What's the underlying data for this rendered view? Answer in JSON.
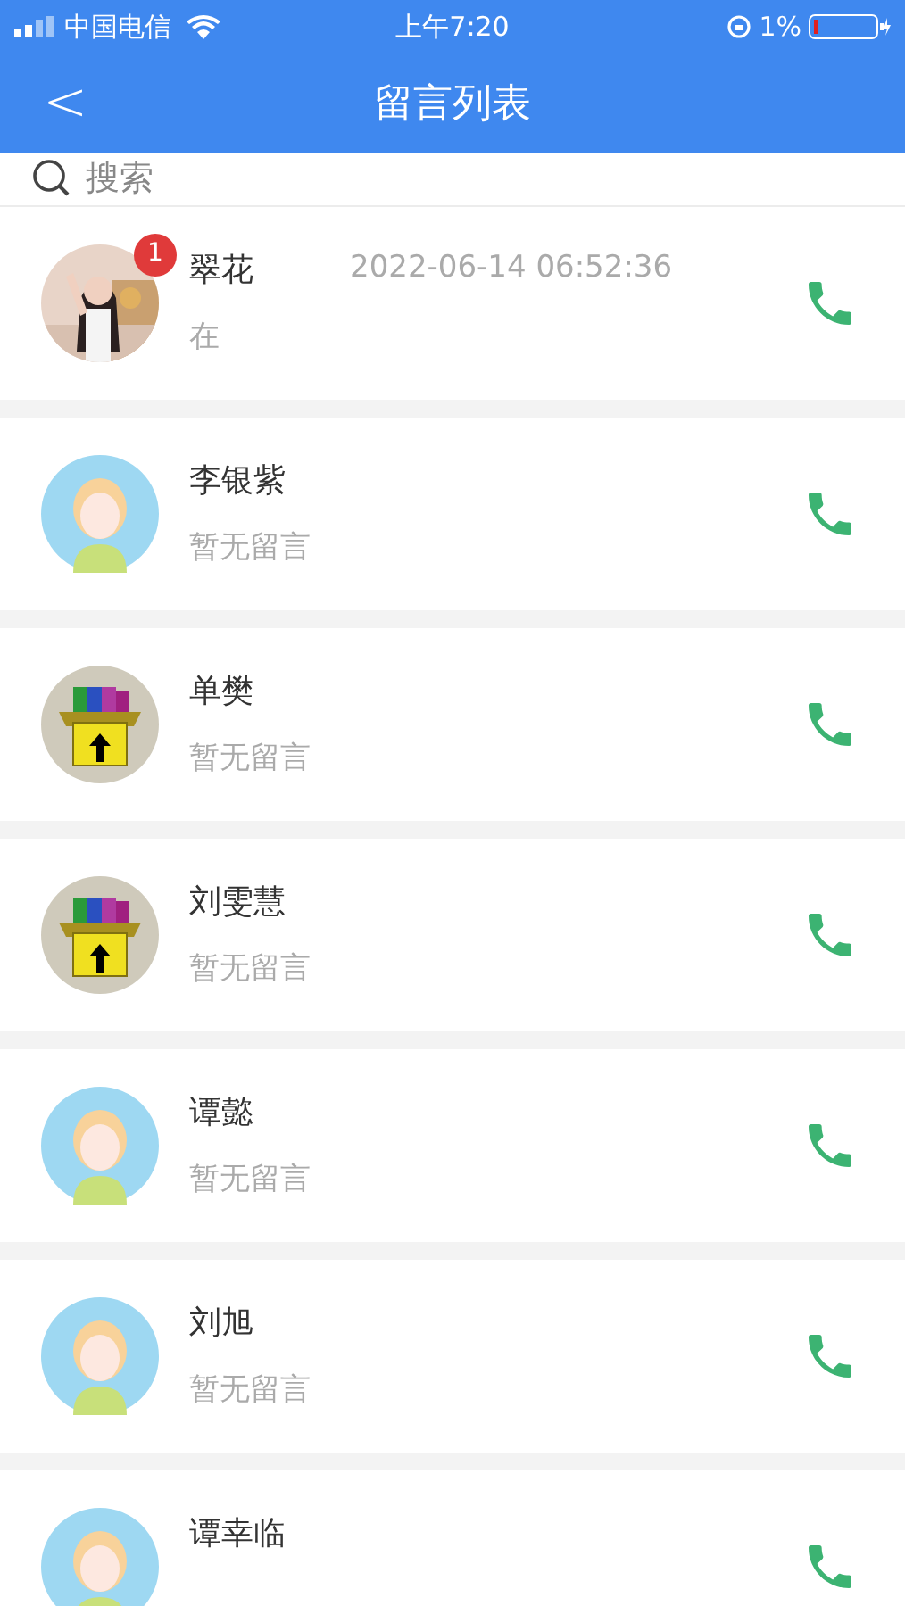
{
  "status_bar": {
    "carrier": "中国电信",
    "time": "上午7:20",
    "battery": "1%"
  },
  "nav": {
    "back": "<",
    "title": "留言列表"
  },
  "search": {
    "placeholder": "搜索"
  },
  "contacts": [
    {
      "name": "翠花",
      "time": "2022-06-14 06:52:36",
      "message": "在",
      "kind": "picture",
      "badge": "1"
    },
    {
      "name": "李银紫",
      "message": "暂无留言",
      "kind": "default"
    },
    {
      "name": "单樊",
      "message": "暂无留言",
      "kind": "archive"
    },
    {
      "name": "刘雯慧",
      "message": "暂无留言",
      "kind": "archive"
    },
    {
      "name": "谭懿",
      "message": "暂无留言",
      "kind": "default"
    },
    {
      "name": "刘旭",
      "message": "暂无留言",
      "kind": "default"
    },
    {
      "name": "谭幸临",
      "kind": "default"
    }
  ]
}
